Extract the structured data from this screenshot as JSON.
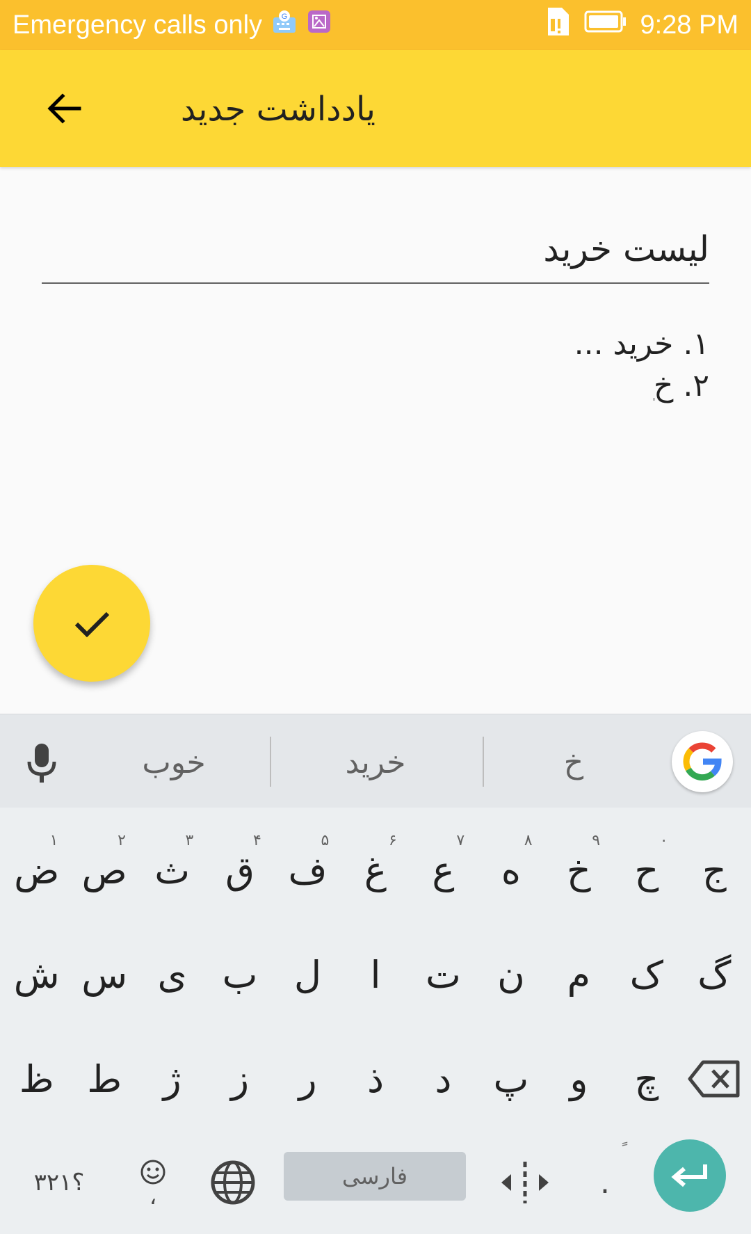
{
  "status_bar": {
    "carrier_text": "Emergency calls only",
    "time": "9:28 PM",
    "icons": [
      "gboard-icon",
      "image-icon",
      "sim-alert-icon",
      "battery-icon"
    ]
  },
  "app_bar": {
    "title": "یادداشت جدید",
    "back_icon": "arrow-back-icon",
    "color": "#fdd835"
  },
  "note": {
    "title_value": "لیست خرید",
    "body_lines": [
      "۱. خرید ...",
      "۲. "
    ],
    "body_composing": "خ"
  },
  "fab": {
    "icon": "check-icon",
    "color": "#fdd835"
  },
  "keyboard": {
    "suggestions": [
      "خوب",
      "خرید",
      "خ"
    ],
    "rows": [
      [
        {
          "label": "ض",
          "hint": "۱"
        },
        {
          "label": "ص",
          "hint": "۲"
        },
        {
          "label": "ث",
          "hint": "۳"
        },
        {
          "label": "ق",
          "hint": "۴"
        },
        {
          "label": "ف",
          "hint": "۵"
        },
        {
          "label": "غ",
          "hint": "۶"
        },
        {
          "label": "ع",
          "hint": "۷"
        },
        {
          "label": "ه",
          "hint": "۸"
        },
        {
          "label": "خ",
          "hint": "۹"
        },
        {
          "label": "ح",
          "hint": "۰"
        },
        {
          "label": "ج",
          "hint": ""
        }
      ],
      [
        {
          "label": "ش"
        },
        {
          "label": "س"
        },
        {
          "label": "ی"
        },
        {
          "label": "ب"
        },
        {
          "label": "ل"
        },
        {
          "label": "ا"
        },
        {
          "label": "ت"
        },
        {
          "label": "ن"
        },
        {
          "label": "م"
        },
        {
          "label": "ک"
        },
        {
          "label": "گ"
        }
      ],
      [
        {
          "label": "ظ"
        },
        {
          "label": "ط"
        },
        {
          "label": "ژ"
        },
        {
          "label": "ز"
        },
        {
          "label": "ر"
        },
        {
          "label": "ذ"
        },
        {
          "label": "د"
        },
        {
          "label": "پ"
        },
        {
          "label": "و"
        },
        {
          "label": "چ"
        }
      ]
    ],
    "symbols_label": "؟۳۲۱",
    "comma_label": "،",
    "period_label": ".",
    "period_hint": "ً",
    "space_label": "فارسی",
    "accent_color": "#4db6ac"
  }
}
